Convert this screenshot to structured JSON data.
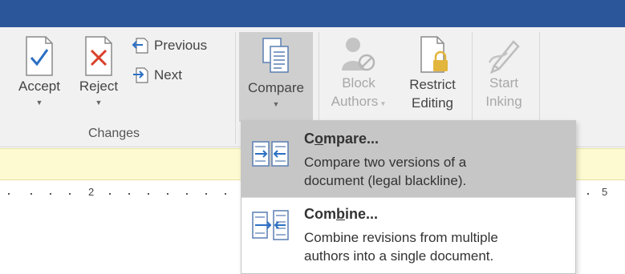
{
  "ribbon": {
    "accept": "Accept",
    "reject": "Reject",
    "previous": "Previous",
    "next": "Next",
    "changes_group": "Changes",
    "compare": "Compare",
    "block_line1": "Block",
    "block_line2": "Authors",
    "restrict_line1": "Restrict",
    "restrict_line2": "Editing",
    "start_line1": "Start",
    "start_line2": "Inking"
  },
  "ruler": {
    "mark_left": "2",
    "mark_right": "5"
  },
  "menu": {
    "compare": {
      "title_pre": "C",
      "title_accel": "o",
      "title_post": "mpare...",
      "desc_line1": "Compare two versions of a",
      "desc_line2": "document (legal blackline)."
    },
    "combine": {
      "title_pre": "Com",
      "title_accel": "b",
      "title_post": "ine...",
      "desc_line1": "Combine revisions from multiple",
      "desc_line2": "authors into a single document."
    }
  },
  "colors": {
    "title_bar": "#2b579a",
    "accept_check": "#2b6fc4",
    "reject_x": "#d9412b",
    "lock": "#e2b53c",
    "highlight": "#c6c6c6"
  }
}
